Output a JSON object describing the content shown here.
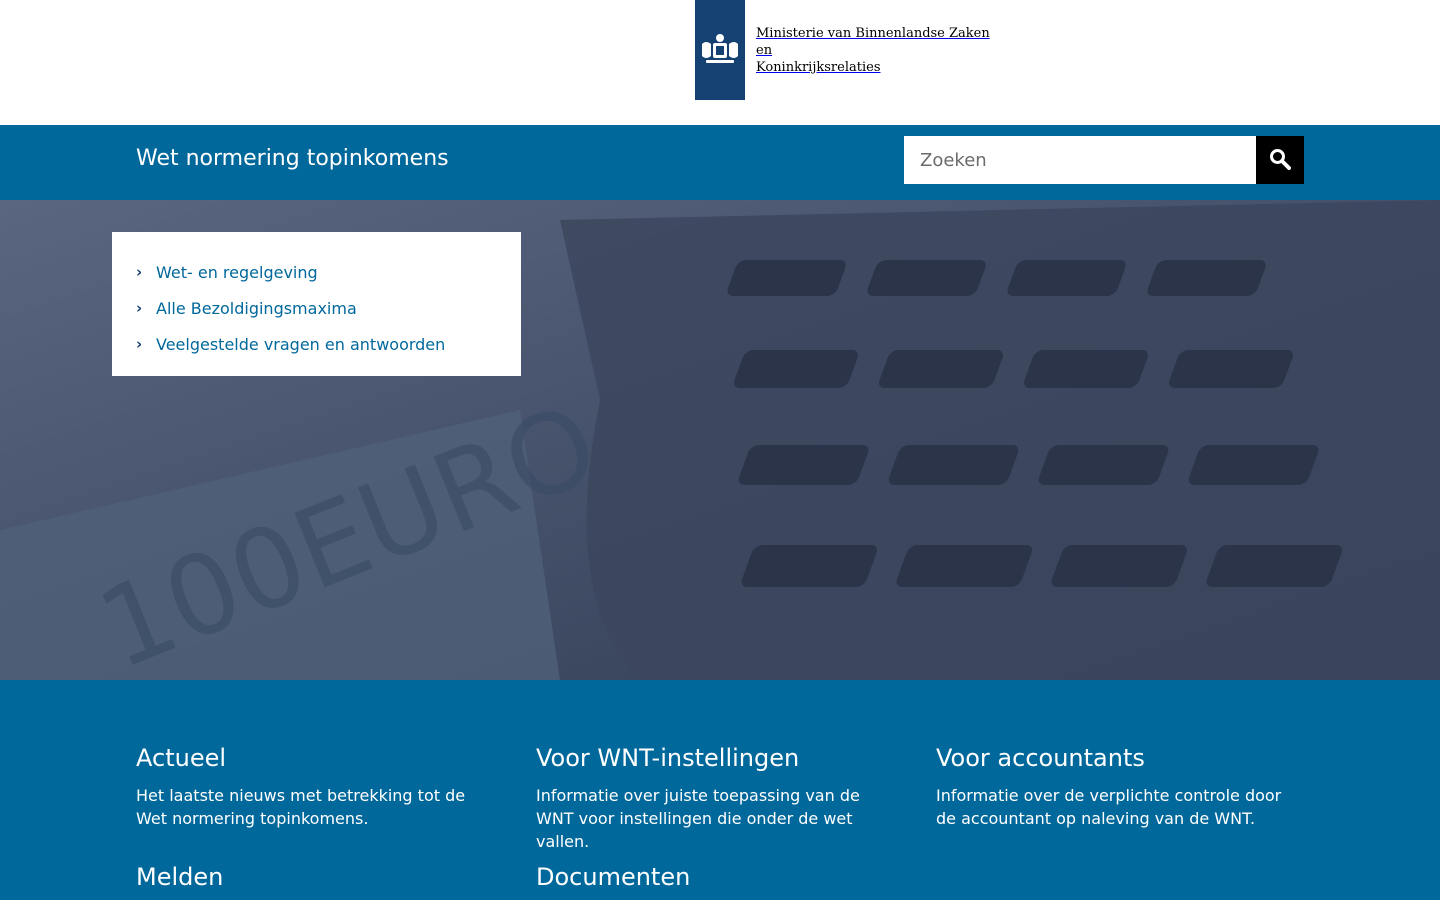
{
  "header": {
    "ministry_line1": "Ministerie van Binnenlandse Zaken en",
    "ministry_line2": "Koninkrijksrelaties"
  },
  "title_bar": {
    "site_title": "Wet normering topinkomens",
    "search_placeholder": "Zoeken"
  },
  "quick_links": [
    {
      "label": "Wet- en regelgeving"
    },
    {
      "label": "Alle Bezoldigingsmaxima"
    },
    {
      "label": "Veelgestelde vragen en antwoorden"
    }
  ],
  "blocks": [
    {
      "title": "Actueel",
      "text": "Het laatste nieuws met betrekking tot de Wet normering topinkomens."
    },
    {
      "title": "Voor WNT-instellingen",
      "text": "Informatie over juiste toepassing van de WNT voor instellingen die onder de wet vallen."
    },
    {
      "title": "Voor accountants",
      "text": "Informatie over de verplichte controle door de accountant op naleving van de WNT."
    },
    {
      "title": "Melden",
      "text": ""
    },
    {
      "title": "Documenten",
      "text": ""
    }
  ],
  "colors": {
    "brand_blue": "#01689b",
    "logo_blue": "#154273",
    "search_button": "#000000"
  }
}
